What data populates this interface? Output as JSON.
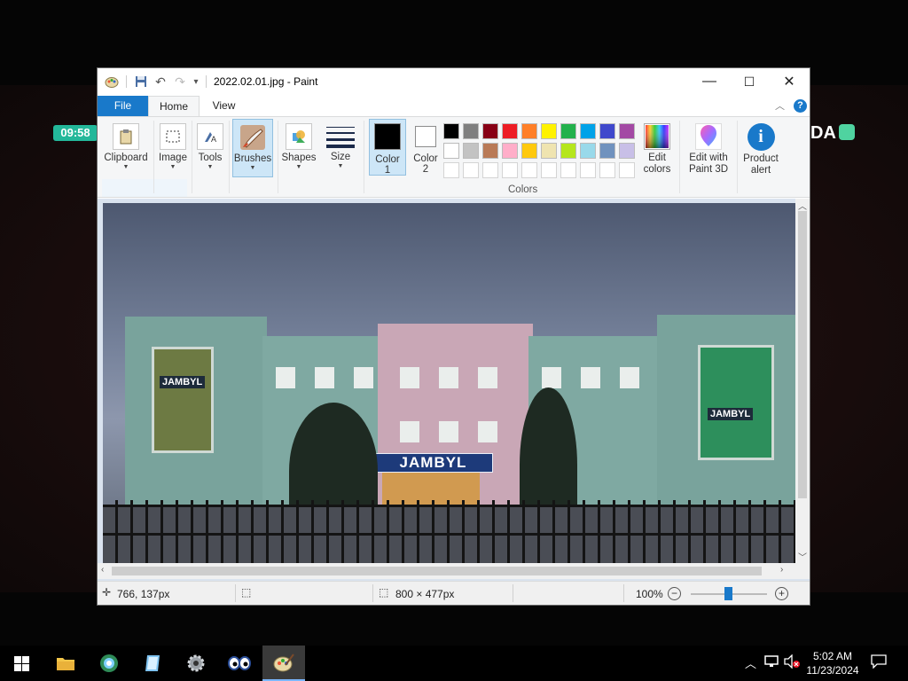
{
  "desktop": {
    "time_badge": "09:58",
    "logo_partial": "DA"
  },
  "window": {
    "title": "2022.02.01.jpg - Paint",
    "controls": {
      "minimize": "—",
      "maximize": "☐",
      "close": "✕"
    }
  },
  "ribbon_tabs": [
    "File",
    "Home",
    "View"
  ],
  "ribbon": {
    "groups": [
      {
        "label": "Clipboard",
        "icon": "clipboard-icon"
      },
      {
        "label": "Image",
        "icon": "select-icon"
      },
      {
        "label": "Tools",
        "icon": "tools-icon"
      },
      {
        "label": "Brushes",
        "icon": "brush-icon",
        "active": true
      },
      {
        "label": "Shapes",
        "icon": "shapes-icon"
      },
      {
        "label": "Size",
        "icon": "size-icon"
      }
    ],
    "color1": {
      "label_line1": "Color",
      "label_line2": "1",
      "value": "#000000"
    },
    "color2": {
      "label_line1": "Color",
      "label_line2": "2",
      "value": "#ffffff"
    },
    "colors_group_label": "Colors",
    "palette_row1": [
      "#000000",
      "#7f7f7f",
      "#880015",
      "#ed1c24",
      "#ff7f27",
      "#fff200",
      "#22b14c",
      "#00a2e8",
      "#3f48cc",
      "#a349a4"
    ],
    "palette_row2": [
      "#ffffff",
      "#c3c3c3",
      "#b97a57",
      "#ffaec9",
      "#ffc90e",
      "#efe4b0",
      "#b5e61d",
      "#99d9ea",
      "#7092be",
      "#c8bfe7"
    ],
    "palette_row3": [
      "#ffffff",
      "#ffffff",
      "#ffffff",
      "#ffffff",
      "#ffffff",
      "#ffffff",
      "#ffffff",
      "#ffffff",
      "#ffffff",
      "#ffffff"
    ],
    "edit_colors": {
      "line1": "Edit",
      "line2": "colors"
    },
    "edit_paint3d": {
      "line1": "Edit with",
      "line2": "Paint 3D"
    },
    "product_alert": {
      "line1": "Product",
      "line2": "alert"
    }
  },
  "image": {
    "sign_text": "JAMBYL",
    "banner_left_text": "JAMBYL",
    "banner_right_text": "JAMBYL"
  },
  "statusbar": {
    "cursor_pos": "766, 137px",
    "image_size": "800 × 477px",
    "zoom": "100%"
  },
  "taskbar": {
    "clock_time": "5:02 AM",
    "clock_date": "11/23/2024"
  }
}
